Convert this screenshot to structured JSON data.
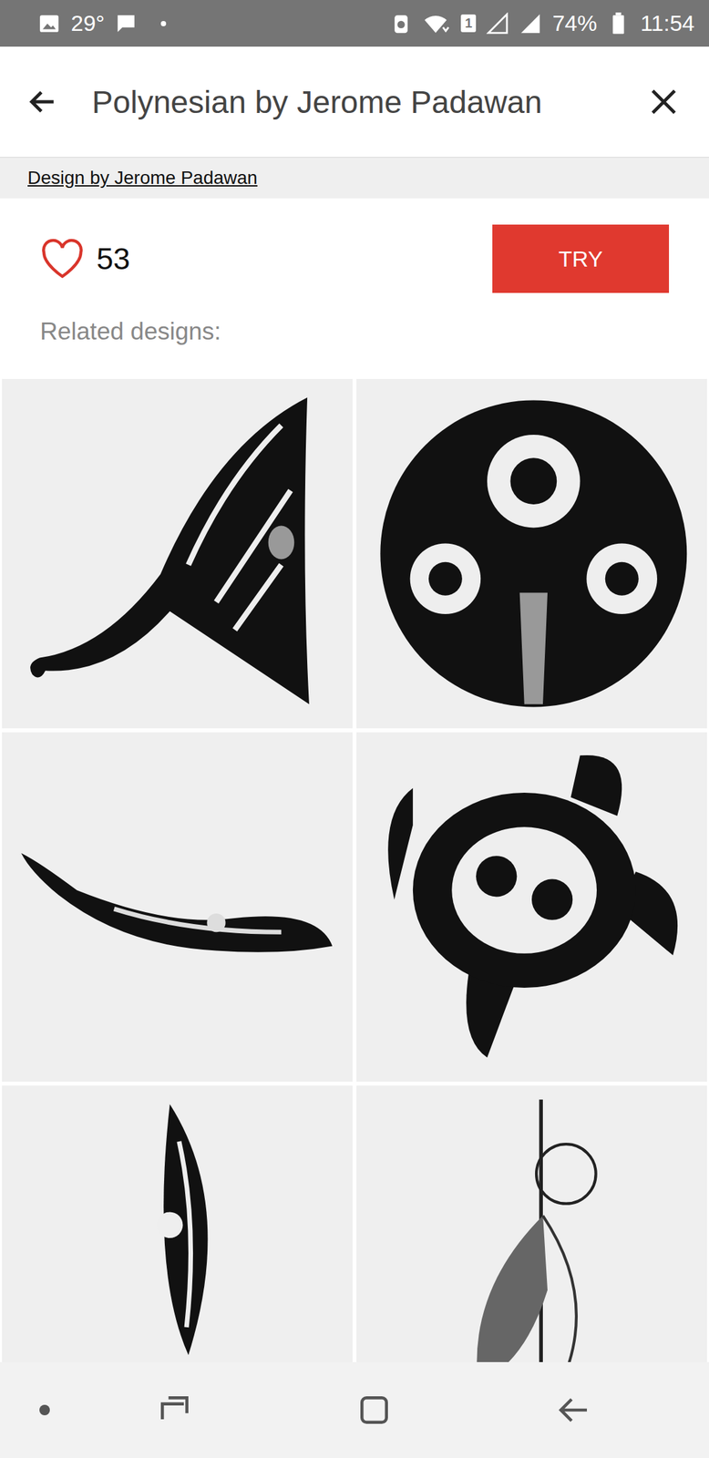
{
  "status_bar": {
    "temperature": "29°",
    "sim_badge": "1",
    "battery": "74%",
    "time": "11:54"
  },
  "app_bar": {
    "title": "Polynesian by Jerome Padawan"
  },
  "credit": "Design by Jerome Padawan",
  "likes": {
    "count": "53",
    "liked": false
  },
  "try_button": "TRY",
  "related": {
    "label": "Related designs:",
    "designs": [
      {
        "kind": "manta"
      },
      {
        "kind": "round"
      },
      {
        "kind": "fish"
      },
      {
        "kind": "turtle"
      },
      {
        "kind": "leaf"
      },
      {
        "kind": "feather"
      }
    ]
  }
}
